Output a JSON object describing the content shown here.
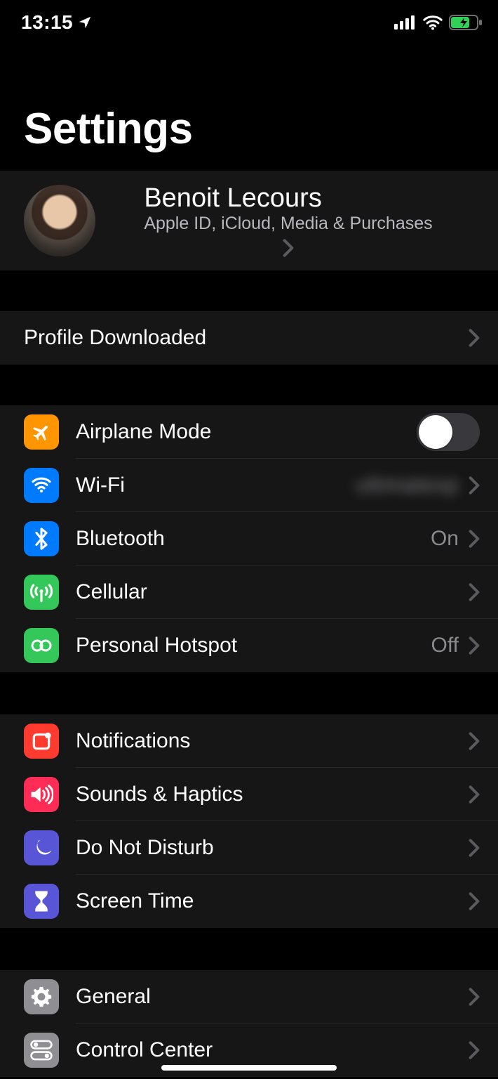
{
  "status": {
    "time": "13:15"
  },
  "page": {
    "title": "Settings"
  },
  "account": {
    "name": "Benoit Lecours",
    "subtitle": "Apple ID, iCloud, Media & Purchases"
  },
  "profile": {
    "label": "Profile Downloaded"
  },
  "connectivity": {
    "airplane": {
      "label": "Airplane Mode",
      "value": "off"
    },
    "wifi": {
      "label": "Wi-Fi",
      "value": "ultimatexp"
    },
    "bluetooth": {
      "label": "Bluetooth",
      "value": "On"
    },
    "cellular": {
      "label": "Cellular"
    },
    "hotspot": {
      "label": "Personal Hotspot",
      "value": "Off"
    }
  },
  "alerts": {
    "notifications": {
      "label": "Notifications"
    },
    "sounds": {
      "label": "Sounds & Haptics"
    },
    "dnd": {
      "label": "Do Not Disturb"
    },
    "screentime": {
      "label": "Screen Time"
    }
  },
  "general_group": {
    "general": {
      "label": "General"
    },
    "controlcenter": {
      "label": "Control Center"
    }
  }
}
